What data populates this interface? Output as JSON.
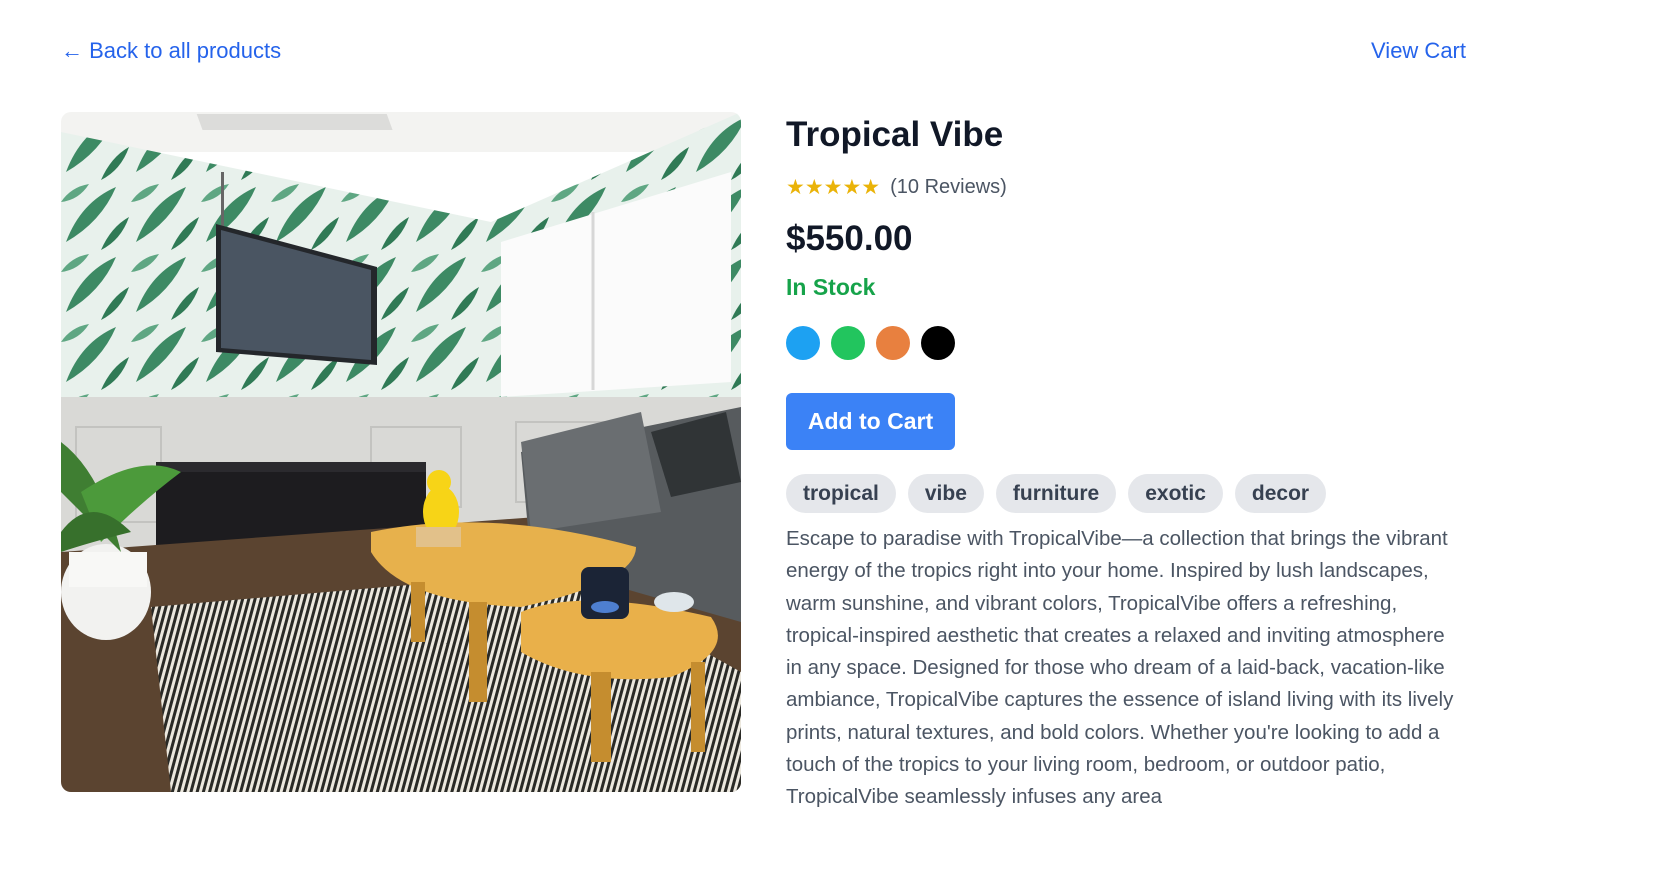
{
  "nav": {
    "back_label": "← Back to all products",
    "cart_label": "View Cart"
  },
  "product": {
    "image_alt": "Living room with tropical palm leaf wallpaper, wall-mounted TV, grey sofa and nested wooden coffee tables",
    "title": "Tropical Vibe",
    "stars": "★★★★★",
    "rating": 5,
    "reviews_label": "(10 Reviews)",
    "price": "$550.00",
    "stock_status": "In Stock",
    "colors": [
      {
        "name": "blue",
        "hex": "#1da1f2"
      },
      {
        "name": "green",
        "hex": "#22c55e"
      },
      {
        "name": "orange",
        "hex": "#e8803f"
      },
      {
        "name": "black",
        "hex": "#000000"
      }
    ],
    "add_to_cart_label": "Add to Cart",
    "tags": [
      "tropical",
      "vibe",
      "furniture",
      "exotic",
      "decor"
    ],
    "description": "Escape to paradise with TropicalVibe—a collection that brings the vibrant energy of the tropics right into your home. Inspired by lush landscapes, warm sunshine, and vibrant colors, TropicalVibe offers a refreshing, tropical-inspired aesthetic that creates a relaxed and inviting atmosphere in any space. Designed for those who dream of a laid-back, vacation-like ambiance, TropicalVibe captures the essence of island living with its lively prints, natural textures, and bold colors. Whether you're looking to add a touch of the tropics to your living room, bedroom, or outdoor patio, TropicalVibe seamlessly infuses any area"
  },
  "theme": {
    "link_color": "#2563eb",
    "button_color": "#3b82f6",
    "stock_color": "#16a34a",
    "star_color": "#eab308",
    "tag_bg": "#e5e7eb"
  }
}
